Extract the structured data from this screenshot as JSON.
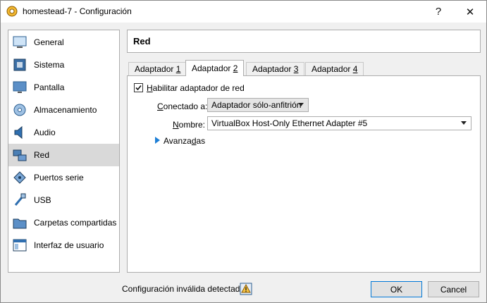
{
  "window": {
    "title": "homestead-7 - Configuración",
    "help_label": "?",
    "close_label": "✕"
  },
  "sidebar": {
    "items": [
      {
        "label": "General",
        "icon": "general-icon"
      },
      {
        "label": "Sistema",
        "icon": "system-icon"
      },
      {
        "label": "Pantalla",
        "icon": "display-icon"
      },
      {
        "label": "Almacenamiento",
        "icon": "storage-icon"
      },
      {
        "label": "Audio",
        "icon": "audio-icon"
      },
      {
        "label": "Red",
        "icon": "network-icon",
        "selected": true
      },
      {
        "label": "Puertos serie",
        "icon": "serial-ports-icon"
      },
      {
        "label": "USB",
        "icon": "usb-icon"
      },
      {
        "label": "Carpetas compartidas",
        "icon": "shared-folders-icon"
      },
      {
        "label": "Interfaz de usuario",
        "icon": "user-interface-icon"
      }
    ]
  },
  "section": {
    "title": "Red"
  },
  "tabs": [
    {
      "prefix": "Adaptador ",
      "key": "1",
      "active": false
    },
    {
      "prefix": "Adaptador ",
      "key": "2",
      "active": true
    },
    {
      "prefix": "Adaptador ",
      "key": "3",
      "active": false
    },
    {
      "prefix": "Adaptador ",
      "key": "4",
      "active": false
    }
  ],
  "adapter": {
    "enable_label_key": "H",
    "enable_label_rest": "abilitar adaptador de red",
    "enabled": true,
    "attached_label_key": "C",
    "attached_label_rest": "onectado a:",
    "attached_value": "Adaptador sólo-anfitrión",
    "name_label_key": "N",
    "name_label_rest": "ombre:",
    "name_value": "VirtualBox Host-Only Ethernet Adapter #5",
    "advanced_label_pre": "Avanza",
    "advanced_label_key": "d",
    "advanced_label_post": "as"
  },
  "status": {
    "text": "Configuración inválida detectada",
    "icon": "warning-icon"
  },
  "buttons": {
    "ok": "OK",
    "cancel": "Cancel"
  },
  "colors": {
    "accent": "#0078d7",
    "selected_bg": "#d9d9d9",
    "arrow": "#1e7fd6"
  }
}
